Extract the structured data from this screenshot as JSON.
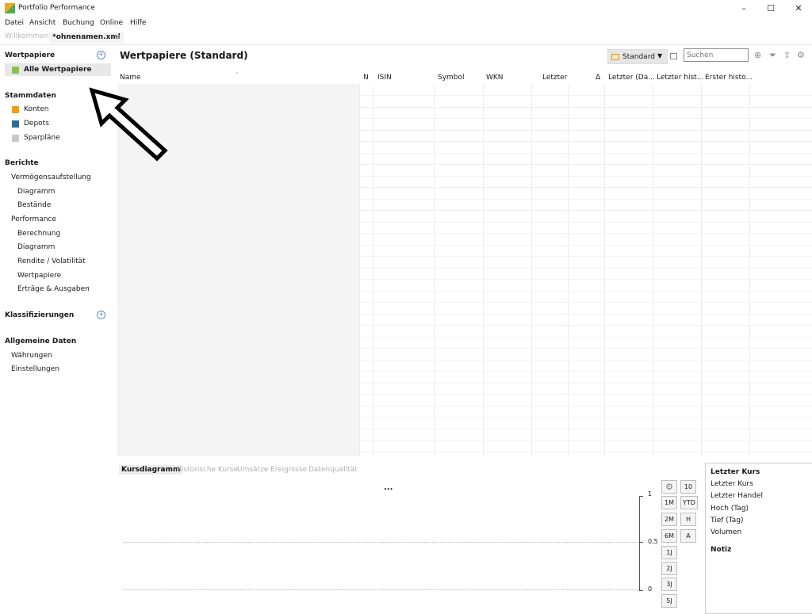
{
  "window": {
    "title": "Portfolio Performance",
    "minimize": "–",
    "maximize": "☐",
    "close": "✕"
  },
  "menu": [
    "Datei",
    "Ansicht",
    "Buchung",
    "Online",
    "Hilfe"
  ],
  "editor_tabs": {
    "welcome": "Willkommen",
    "file": "*ohnenamen.xml",
    "close_symbol": "⊠"
  },
  "sidebar": {
    "wertpapiere": {
      "heading": "Wertpapiere",
      "alle": "Alle Wertpapiere"
    },
    "stammdaten": {
      "heading": "Stammdaten",
      "items": [
        {
          "label": "Konten",
          "color": "#f39c12"
        },
        {
          "label": "Depots",
          "color": "#2a6f97"
        },
        {
          "label": "Sparpläne",
          "color": "#c8c8c8"
        }
      ]
    },
    "berichte": {
      "heading": "Berichte",
      "items": [
        "Vermögensaufstellung",
        "Diagramm",
        "Bestände",
        "Performance",
        "Berechnung",
        "Diagramm",
        "Rendite / Volatilität",
        "Wertpapiere",
        "Erträge & Ausgaben"
      ]
    },
    "klassifizierungen": {
      "heading": "Klassifizierungen"
    },
    "allgemein": {
      "heading": "Allgemeine Daten",
      "items": [
        "Währungen",
        "Einstellungen"
      ]
    }
  },
  "main": {
    "title": "Wertpapiere (Standard)",
    "view_select": "Standard",
    "search_placeholder": "Suchen",
    "columns": [
      "Name",
      "N",
      "ISIN",
      "Symbol",
      "WKN",
      "Letzter",
      "Δ",
      "Letzter (Da...",
      "Letzter hist...",
      "Erster histo..."
    ]
  },
  "bottom": {
    "tabs": [
      "Kursdiagramm",
      "Historische Kurse",
      "Umsätze",
      "Ereignisse",
      "Datenqualität"
    ],
    "more": "...",
    "buttons": [
      "10",
      "1M",
      "YTD",
      "2M",
      "H",
      "6M",
      "A",
      "1J",
      "2J",
      "3J",
      "5J"
    ],
    "y_ticks": [
      "1",
      "0,5",
      "0"
    ]
  },
  "info": {
    "header": "Letzter Kurs",
    "lines": [
      "Letzter Kurs",
      "Letzter Handel",
      "Hoch (Tag)",
      "Tief (Tag)",
      "Volumen"
    ],
    "note": "Notiz"
  }
}
